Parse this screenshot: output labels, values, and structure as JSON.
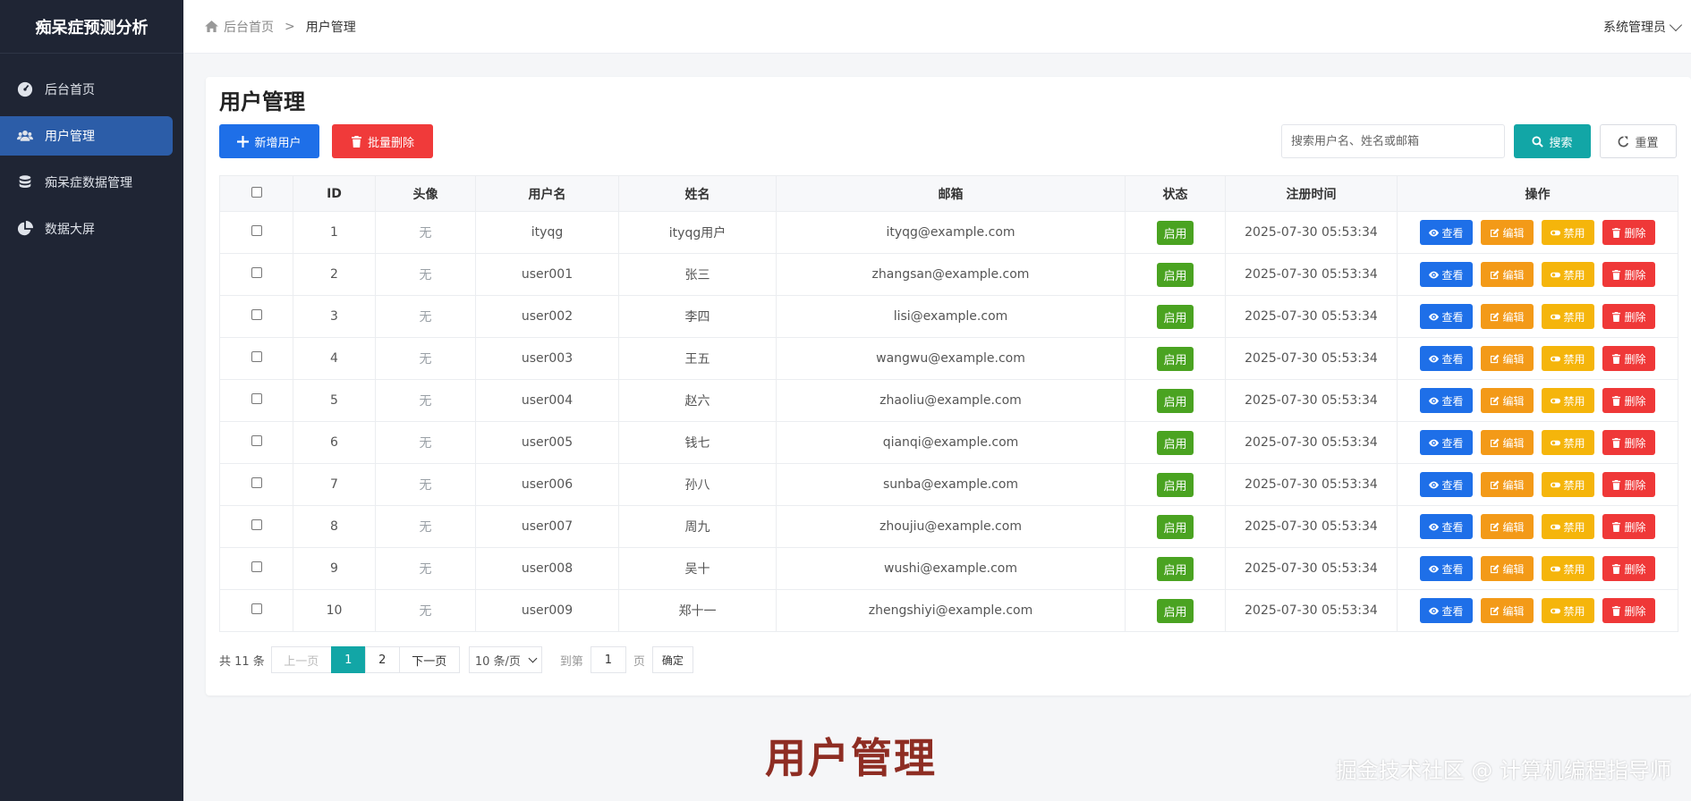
{
  "app": {
    "brand": "痴呆症预测分析"
  },
  "sidebar": {
    "items": [
      {
        "label": "后台首页",
        "icon": "dashboard-icon",
        "active": false
      },
      {
        "label": "用户管理",
        "icon": "users-icon",
        "active": true
      },
      {
        "label": "痴呆症数据管理",
        "icon": "database-icon",
        "active": false
      },
      {
        "label": "数据大屏",
        "icon": "pie-chart-icon",
        "active": false
      }
    ]
  },
  "header": {
    "breadcrumb": {
      "home": "后台首页",
      "separator": ">",
      "current": "用户管理"
    },
    "user": "系统管理员"
  },
  "main": {
    "title": "用户管理",
    "toolbar": {
      "add_label": "新增用户",
      "batch_delete_label": "批量删除",
      "search_placeholder": "搜索用户名、姓名或邮箱",
      "search_label": "搜索",
      "reset_label": "重置"
    },
    "table": {
      "headers": [
        "ID",
        "头像",
        "用户名",
        "姓名",
        "邮箱",
        "状态",
        "注册时间",
        "操作"
      ],
      "rows": [
        {
          "id": "1",
          "avatar": "无",
          "username": "ityqg",
          "name": "ityqg用户",
          "email": "ityqg@example.com",
          "status": "启用",
          "registered": "2025-07-30 05:53:34"
        },
        {
          "id": "2",
          "avatar": "无",
          "username": "user001",
          "name": "张三",
          "email": "zhangsan@example.com",
          "status": "启用",
          "registered": "2025-07-30 05:53:34"
        },
        {
          "id": "3",
          "avatar": "无",
          "username": "user002",
          "name": "李四",
          "email": "lisi@example.com",
          "status": "启用",
          "registered": "2025-07-30 05:53:34"
        },
        {
          "id": "4",
          "avatar": "无",
          "username": "user003",
          "name": "王五",
          "email": "wangwu@example.com",
          "status": "启用",
          "registered": "2025-07-30 05:53:34"
        },
        {
          "id": "5",
          "avatar": "无",
          "username": "user004",
          "name": "赵六",
          "email": "zhaoliu@example.com",
          "status": "启用",
          "registered": "2025-07-30 05:53:34"
        },
        {
          "id": "6",
          "avatar": "无",
          "username": "user005",
          "name": "钱七",
          "email": "qianqi@example.com",
          "status": "启用",
          "registered": "2025-07-30 05:53:34"
        },
        {
          "id": "7",
          "avatar": "无",
          "username": "user006",
          "name": "孙八",
          "email": "sunba@example.com",
          "status": "启用",
          "registered": "2025-07-30 05:53:34"
        },
        {
          "id": "8",
          "avatar": "无",
          "username": "user007",
          "name": "周九",
          "email": "zhoujiu@example.com",
          "status": "启用",
          "registered": "2025-07-30 05:53:34"
        },
        {
          "id": "9",
          "avatar": "无",
          "username": "user008",
          "name": "吴十",
          "email": "wushi@example.com",
          "status": "启用",
          "registered": "2025-07-30 05:53:34"
        },
        {
          "id": "10",
          "avatar": "无",
          "username": "user009",
          "name": "郑十一",
          "email": "zhengshiyi@example.com",
          "status": "启用",
          "registered": "2025-07-30 05:53:34"
        }
      ],
      "actions": {
        "view": "查看",
        "edit": "编辑",
        "disable": "禁用",
        "delete": "删除"
      }
    },
    "pagination": {
      "total": "共 11 条",
      "prev": "上一页",
      "pages": [
        "1",
        "2"
      ],
      "current_page": "1",
      "next": "下一页",
      "page_size": "10 条/页",
      "goto_label": "到第",
      "goto_value": "1",
      "page_unit": "页",
      "confirm": "确定"
    }
  },
  "overlay": {
    "caption": "用户管理",
    "watermark": "掘金技术社区 @ 计算机编程指导师"
  },
  "colors": {
    "sidebar_bg": "#1f2534",
    "sidebar_active": "#2c5da8",
    "primary": "#1e6fe8",
    "danger": "#f03a3a",
    "teal": "#12a6a6",
    "status_green": "#4aa321",
    "edit_orange": "#f39a18",
    "disable_yellow": "#f5b50b",
    "caption_red": "#8e2d23"
  }
}
